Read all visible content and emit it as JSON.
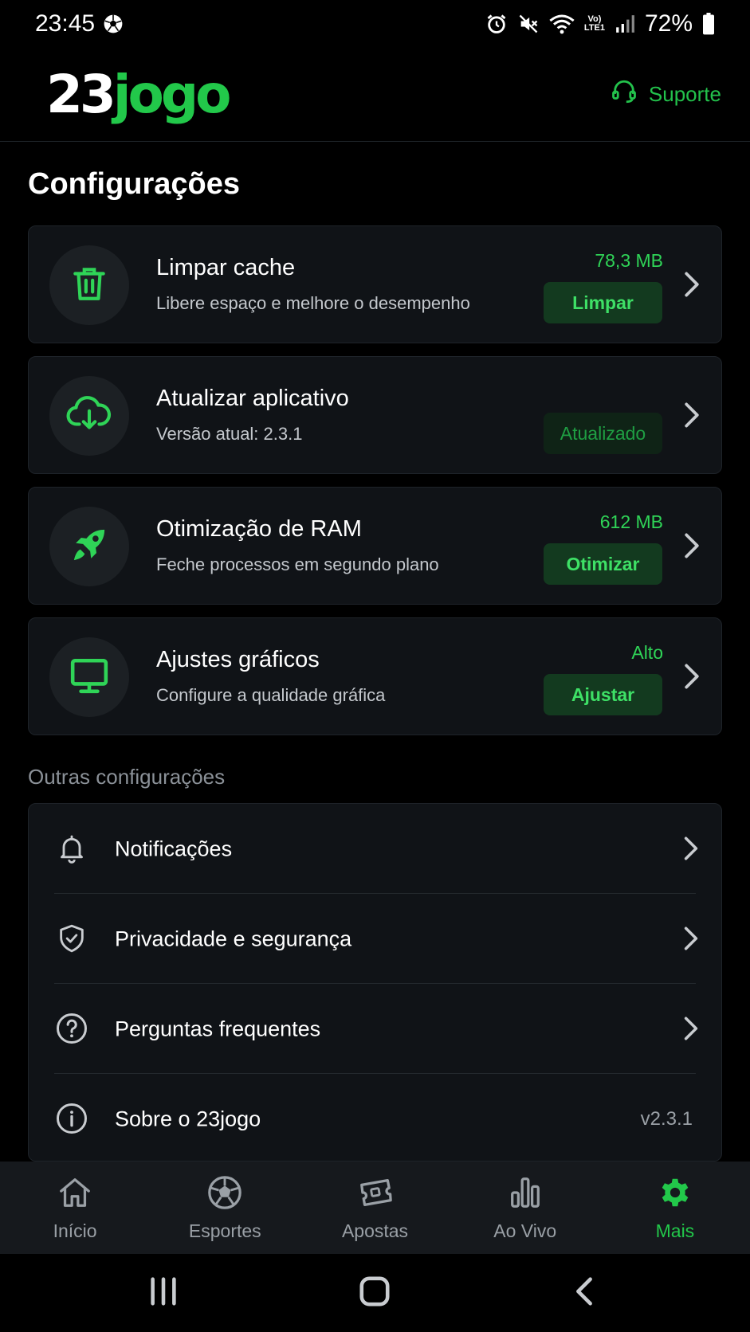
{
  "status_bar": {
    "time": "23:45",
    "network_small": "Vo)\nLTE1",
    "battery": "72%"
  },
  "header": {
    "logo_part1": "23",
    "logo_part2": "jogo",
    "support_label": "Suporte"
  },
  "page_title": "Configurações",
  "cards": [
    {
      "icon": "trash-icon",
      "title": "Limpar cache",
      "subtitle": "Libere espaço e melhore o desempenho",
      "value": "78,3 MB",
      "button": "Limpar"
    },
    {
      "icon": "cloud-download-icon",
      "title": "Atualizar aplicativo",
      "subtitle": "Versão atual: 2.3.1",
      "value": "",
      "button": "Atualizado"
    },
    {
      "icon": "rocket-icon",
      "title": "Otimização de RAM",
      "subtitle": "Feche processos em segundo plano",
      "value": "612 MB",
      "button": "Otimizar"
    },
    {
      "icon": "monitor-icon",
      "title": "Ajustes gráficos",
      "subtitle": "Configure a qualidade gráfica",
      "value": "Alto",
      "button": "Ajustar"
    }
  ],
  "other_section": {
    "label": "Outras configurações",
    "items": [
      {
        "icon": "bell-icon",
        "label": "Notificações"
      },
      {
        "icon": "shield-icon",
        "label": "Privacidade e segurança"
      },
      {
        "icon": "question-icon",
        "label": "Perguntas frequentes"
      },
      {
        "icon": "info-icon",
        "label": "Sobre o 23jogo",
        "value": "v2.3.1"
      }
    ]
  },
  "bottom_nav": [
    {
      "icon": "home-icon",
      "label": "Início",
      "active": false
    },
    {
      "icon": "soccer-ball-icon",
      "label": "Esportes",
      "active": false
    },
    {
      "icon": "ticket-icon",
      "label": "Apostas",
      "active": false
    },
    {
      "icon": "bar-chart-icon",
      "label": "Ao Vivo",
      "active": false
    },
    {
      "icon": "gear-icon",
      "label": "Mais",
      "active": true
    }
  ],
  "colors": {
    "accent": "#22c84a",
    "background": "#000000",
    "card": "#101317",
    "button_bg": "#133a1f"
  }
}
